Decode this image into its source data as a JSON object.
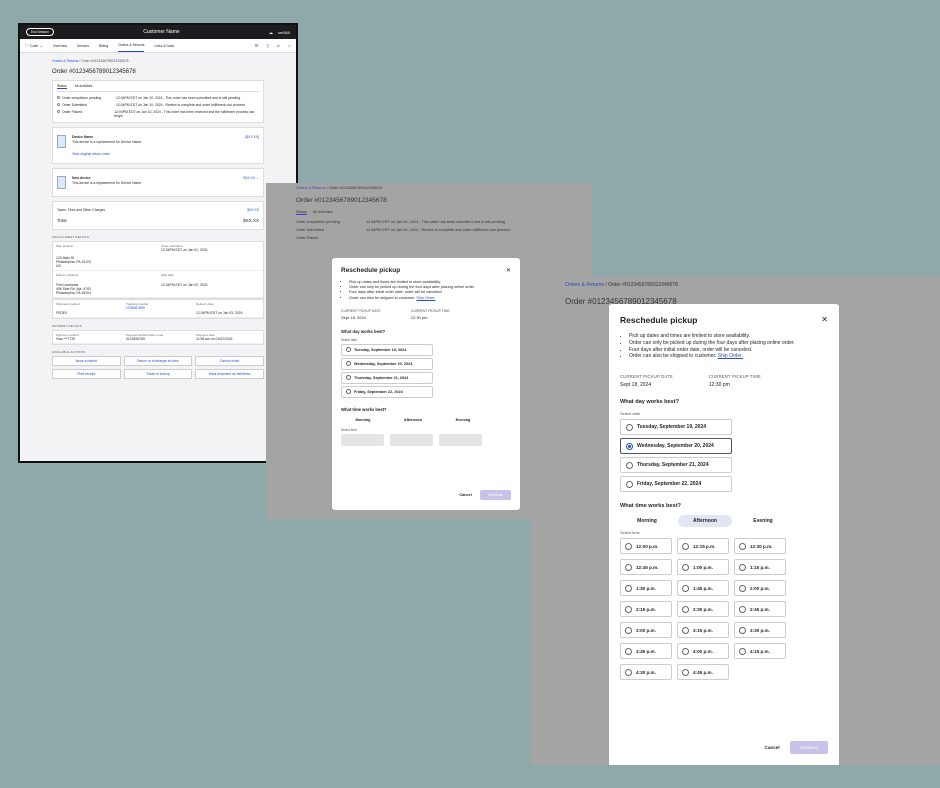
{
  "screen1": {
    "end_session": "End Session",
    "customer_name": "Customer Name",
    "logo": "xm360",
    "nav_dropdown": "Care",
    "tabs": [
      "Overview",
      "Devices",
      "Billing",
      "Orders & Returns",
      "Links & Data"
    ],
    "breadcrumb_link": "Orders & Returns",
    "breadcrumb_current": "Order #0123456789012345678",
    "order_title": "Order #0123456789012345678",
    "status_tabs": [
      "Status",
      "All activities"
    ],
    "status_rows": [
      {
        "label": "Order completion pending",
        "text": "12:04PM EDT on Jan 10, 2024 - This order has been submitted and is still pending"
      },
      {
        "label": "Order Submitted",
        "text": "12:04PM EDT on Jan 10, 2024 - Review is complete and order fulfillment can proceed"
      },
      {
        "label": "Order Placed",
        "text": "12:04PM EDT on Jan 10, 2024 - This order has been received and the fulfillment process can begin"
      }
    ],
    "devices": [
      {
        "name": "Device Name",
        "desc": "This device is a replacement for Device Name",
        "price": "[$XX.XX]",
        "link": "View original return order"
      },
      {
        "name": "New device",
        "desc": "This device is a replacement for Device Name",
        "price": "$XX.XX",
        "link": ""
      }
    ],
    "taxes_label": "Taxes, Fees and Other Charges",
    "taxes_price": "$XX.XX",
    "total_label": "Total",
    "total_value": "$XX.XX",
    "fulfillment_header": "FULFILLMENT DETAILS",
    "ship_label": "Ship location",
    "ship_addr": [
      "123 Main St",
      "Philadelphia, PA 19103",
      "US"
    ],
    "order_submitted_label": "Order submitted",
    "order_submitted_val": "12:34PM EDT on Jan 01, 2024",
    "delivery_label": "Delivery address",
    "delivery_addr": [
      "First Lastname",
      "456 Side Rd, Apt. #703",
      "Philadelphia, PA 19104"
    ],
    "ship_date_label": "Ship date",
    "ship_date_val": "12:34PM EDT on Jan 02, 2024",
    "shipment_method_label": "Shipment method",
    "shipment_method_val": "FEDEX",
    "tracking_label": "Tracking number",
    "tracking_val": "1234567890",
    "delivery_date_label": "Delivery date",
    "delivery_date_val": "12:34PM EDT on Jan 03, 2024",
    "payment_header": "PAYMENT DETAILS",
    "payment_method_label": "Payment method",
    "payment_method_val": "Visa ***7739",
    "payment_auth_label": "Payment authorization code",
    "payment_auth_val": "0123456789",
    "payment_date_label": "Payment date",
    "payment_date_val": "11:55 am on 01/02/2024",
    "actions_header": "AVAILABLE ACTIONS",
    "actions": [
      "Issue a refund",
      "Return or exchange an item",
      "Cancel order",
      "Print receipt",
      "Trade-in lookup",
      "Mark shipment as delivered"
    ]
  },
  "screen2": {
    "breadcrumb_link": "Orders & Returns",
    "breadcrumb_current": "Order #0123456789012345678",
    "order_title": "Order #0123456789012345678",
    "tabs": [
      "Status",
      "All activities"
    ],
    "status_rows": [
      {
        "label": "Order completion pending",
        "text": "12:34PM EDT on Jan 10, 2024 - This order has been submitted and is still pending"
      },
      {
        "label": "Order Submitted",
        "text": "12:34PM EDT on Jan 10, 2024 - Review is complete and order fulfillment can proceed"
      },
      {
        "label": "Order Placed",
        "text": ""
      }
    ],
    "modal": {
      "title": "Reschedule pickup",
      "bullets": [
        "Pick up dates and times are limited to store availability.",
        "Order can only be picked up during the four days after placing online order.",
        "Four days after initial order date, order will be canceled.",
        "Order can also be shipped to customer."
      ],
      "ship_link": "Ship Order.",
      "current_date_label": "CURRENT PICKUP DATE",
      "current_date": "Sept 18, 2024",
      "current_time_label": "CURRENT PICKUP TIME",
      "current_time": "12:30 pm",
      "day_question": "What day works best?",
      "select_date": "Select date",
      "dates": [
        "Tuesday, September 19, 2024",
        "Wednesday, September 20, 2024",
        "Thursday, September 21, 2024",
        "Friday, September 22, 2024"
      ],
      "time_question": "What time works best?",
      "slots": [
        "Morning",
        "Afternoon",
        "Evening"
      ],
      "select_time": "Select time",
      "cancel": "Cancel",
      "continue": "Continue"
    }
  },
  "screen3": {
    "breadcrumb_link": "Orders & Returns",
    "breadcrumb_current": "Order #0123456789012345678",
    "order_title": "Order #0123456789012345678",
    "modal": {
      "title": "Reschedule pickup",
      "bullets": [
        "Pick up dates and times are limited to store availability.",
        "Order can only be picked up during the four days after placing online order.",
        "Four days after initial order date, order will be canceled.",
        "Order can also be shipped to customer."
      ],
      "ship_link": "Ship Order.",
      "current_date_label": "CURRENT PICKUP DATE",
      "current_date": "Sept 18, 2024",
      "current_time_label": "CURRENT PICKUP TIME",
      "current_time": "12:30 pm",
      "day_question": "What day works best?",
      "select_date": "Select date",
      "dates": [
        "Tuesday, September 19, 2024",
        "Wednesday, September 20, 2024",
        "Thursday, September 21, 2024",
        "Friday, September 22, 2024"
      ],
      "selected_date_index": 1,
      "time_question": "What time works best?",
      "slots": [
        "Morning",
        "Afternoon",
        "Evening"
      ],
      "selected_slot": "Afternoon",
      "select_time": "Select time",
      "times": [
        "12:00 p.m.",
        "12:15 p.m.",
        "12:30 p.m.",
        "12:45 p.m.",
        "1:00 p.m.",
        "1:15 p.m.",
        "1:30 p.m.",
        "1:45 p.m.",
        "2:00 p.m.",
        "2:15 p.m.",
        "2:30 p.m.",
        "2:45 p.m.",
        "3:00 p.m.",
        "3:15 p.m.",
        "3:30 p.m.",
        "3:45 p.m.",
        "4:00 p.m.",
        "4:15 p.m.",
        "4:30 p.m.",
        "4:45 p.m."
      ],
      "cancel": "Cancel",
      "continue": "Continue"
    }
  },
  "colors": {
    "accent": "#1f4fd6",
    "backdrop": "#8fa8aa",
    "continue_disabled": "#c9c2e8"
  }
}
